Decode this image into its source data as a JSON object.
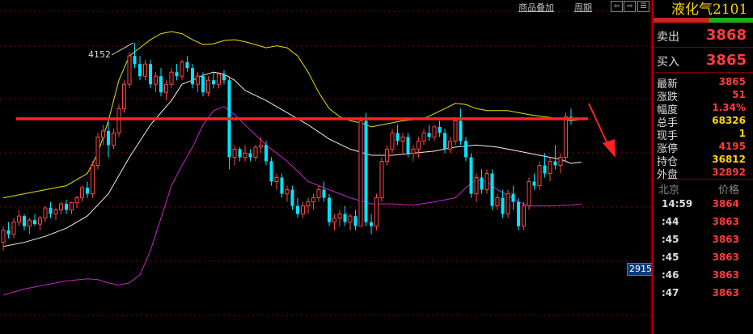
{
  "toolbar": {
    "overlay_label": "商品叠加",
    "period_label": "周期",
    "nav_buttons": [
      "⇦",
      "⇨",
      "☰"
    ]
  },
  "chart": {
    "high_label": "4152",
    "price_tag": "2915",
    "colors": {
      "up": "#ff4444",
      "down": "#00e5ff",
      "upper_band": "#e8e000",
      "mid_band": "#f0f0e0",
      "lower_band": "#cc22cc",
      "resistance_line": "#ff2222",
      "arrow": "#ff2222",
      "grid": "#8b0000"
    }
  },
  "chart_data": {
    "type": "candlestick",
    "ohlc": [
      [
        3660,
        3700,
        3640,
        3690
      ],
      [
        3690,
        3710,
        3670,
        3680
      ],
      [
        3680,
        3720,
        3670,
        3710
      ],
      [
        3710,
        3740,
        3700,
        3725
      ],
      [
        3725,
        3730,
        3690,
        3700
      ],
      [
        3700,
        3720,
        3680,
        3715
      ],
      [
        3715,
        3730,
        3700,
        3705
      ],
      [
        3705,
        3725,
        3690,
        3720
      ],
      [
        3720,
        3750,
        3710,
        3745
      ],
      [
        3745,
        3760,
        3720,
        3730
      ],
      [
        3730,
        3745,
        3715,
        3740
      ],
      [
        3740,
        3760,
        3730,
        3755
      ],
      [
        3755,
        3765,
        3730,
        3740
      ],
      [
        3740,
        3760,
        3730,
        3758
      ],
      [
        3758,
        3775,
        3745,
        3770
      ],
      [
        3770,
        3800,
        3760,
        3795
      ],
      [
        3795,
        3810,
        3770,
        3780
      ],
      [
        3780,
        3860,
        3770,
        3850
      ],
      [
        3850,
        3930,
        3840,
        3920
      ],
      [
        3920,
        3950,
        3900,
        3935
      ],
      [
        3935,
        3960,
        3870,
        3900
      ],
      [
        3900,
        3940,
        3890,
        3930
      ],
      [
        3930,
        4000,
        3920,
        3990
      ],
      [
        3990,
        4060,
        3980,
        4050
      ],
      [
        4050,
        4130,
        4040,
        4120
      ],
      [
        4120,
        4152,
        4090,
        4100
      ],
      [
        4100,
        4120,
        4060,
        4070
      ],
      [
        4070,
        4110,
        4060,
        4100
      ],
      [
        4100,
        4110,
        4040,
        4050
      ],
      [
        4050,
        4080,
        4030,
        4070
      ],
      [
        4070,
        4090,
        4020,
        4030
      ],
      [
        4030,
        4060,
        4010,
        4050
      ],
      [
        4050,
        4090,
        4040,
        4080
      ],
      [
        4080,
        4100,
        4060,
        4070
      ],
      [
        4070,
        4110,
        4060,
        4105
      ],
      [
        4105,
        4120,
        4080,
        4090
      ],
      [
        4090,
        4100,
        4040,
        4050
      ],
      [
        4050,
        4080,
        4030,
        4070
      ],
      [
        4070,
        4080,
        4020,
        4030
      ],
      [
        4030,
        4070,
        4020,
        4060
      ],
      [
        4060,
        4080,
        4040,
        4050
      ],
      [
        4050,
        4080,
        4040,
        4075
      ],
      [
        4075,
        4085,
        4050,
        4060
      ],
      [
        4060,
        4070,
        3840,
        3870
      ],
      [
        3870,
        3900,
        3850,
        3890
      ],
      [
        3890,
        3895,
        3860,
        3870
      ],
      [
        3870,
        3900,
        3860,
        3880
      ],
      [
        3880,
        3890,
        3860,
        3870
      ],
      [
        3870,
        3900,
        3860,
        3895
      ],
      [
        3895,
        3920,
        3880,
        3900
      ],
      [
        3900,
        3910,
        3850,
        3860
      ],
      [
        3860,
        3870,
        3800,
        3810
      ],
      [
        3810,
        3830,
        3790,
        3820
      ],
      [
        3820,
        3830,
        3770,
        3780
      ],
      [
        3780,
        3800,
        3760,
        3790
      ],
      [
        3790,
        3800,
        3740,
        3750
      ],
      [
        3750,
        3770,
        3720,
        3730
      ],
      [
        3730,
        3760,
        3720,
        3750
      ],
      [
        3750,
        3770,
        3730,
        3760
      ],
      [
        3760,
        3780,
        3740,
        3770
      ],
      [
        3770,
        3800,
        3760,
        3790
      ],
      [
        3790,
        3810,
        3760,
        3770
      ],
      [
        3770,
        3780,
        3700,
        3710
      ],
      [
        3710,
        3730,
        3690,
        3720
      ],
      [
        3720,
        3740,
        3700,
        3730
      ],
      [
        3730,
        3750,
        3700,
        3710
      ],
      [
        3710,
        3730,
        3690,
        3725
      ],
      [
        3725,
        3740,
        3690,
        3700
      ],
      [
        3700,
        3970,
        3700,
        3960
      ],
      [
        3960,
        3980,
        3700,
        3710
      ],
      [
        3710,
        3730,
        3680,
        3700
      ],
      [
        3700,
        3780,
        3690,
        3770
      ],
      [
        3770,
        3870,
        3760,
        3860
      ],
      [
        3860,
        3900,
        3850,
        3890
      ],
      [
        3890,
        3940,
        3880,
        3930
      ],
      [
        3930,
        3950,
        3900,
        3910
      ],
      [
        3910,
        3930,
        3880,
        3920
      ],
      [
        3920,
        3930,
        3870,
        3880
      ],
      [
        3880,
        3900,
        3860,
        3890
      ],
      [
        3890,
        3920,
        3870,
        3910
      ],
      [
        3910,
        3940,
        3900,
        3930
      ],
      [
        3930,
        3950,
        3910,
        3920
      ],
      [
        3920,
        3950,
        3910,
        3945
      ],
      [
        3945,
        3960,
        3920,
        3930
      ],
      [
        3930,
        3940,
        3880,
        3890
      ],
      [
        3890,
        3920,
        3880,
        3910
      ],
      [
        3910,
        3970,
        3900,
        3960
      ],
      [
        3960,
        3990,
        3900,
        3910
      ],
      [
        3910,
        3920,
        3860,
        3870
      ],
      [
        3870,
        3880,
        3770,
        3780
      ],
      [
        3780,
        3830,
        3760,
        3820
      ],
      [
        3820,
        3840,
        3780,
        3790
      ],
      [
        3790,
        3840,
        3780,
        3830
      ],
      [
        3830,
        3840,
        3740,
        3750
      ],
      [
        3750,
        3780,
        3740,
        3770
      ],
      [
        3770,
        3790,
        3720,
        3730
      ],
      [
        3730,
        3790,
        3720,
        3780
      ],
      [
        3780,
        3800,
        3740,
        3760
      ],
      [
        3760,
        3770,
        3690,
        3700
      ],
      [
        3700,
        3760,
        3690,
        3750
      ],
      [
        3750,
        3820,
        3740,
        3810
      ],
      [
        3810,
        3830,
        3790,
        3800
      ],
      [
        3800,
        3860,
        3790,
        3850
      ],
      [
        3850,
        3880,
        3820,
        3830
      ],
      [
        3830,
        3870,
        3810,
        3860
      ],
      [
        3860,
        3900,
        3840,
        3850
      ],
      [
        3850,
        3880,
        3830,
        3870
      ],
      [
        3870,
        3980,
        3860,
        3970
      ],
      [
        3970,
        3990,
        3950,
        3965
      ]
    ],
    "bands": {
      "upper": [
        [
          0,
          3770
        ],
        [
          4,
          3780
        ],
        [
          8,
          3790
        ],
        [
          12,
          3800
        ],
        [
          16,
          3830
        ],
        [
          18,
          3880
        ],
        [
          20,
          3960
        ],
        [
          22,
          4060
        ],
        [
          24,
          4120
        ],
        [
          26,
          4140
        ],
        [
          28,
          4160
        ],
        [
          30,
          4175
        ],
        [
          32,
          4180
        ],
        [
          34,
          4175
        ],
        [
          36,
          4160
        ],
        [
          38,
          4148
        ],
        [
          40,
          4150
        ],
        [
          42,
          4158
        ],
        [
          44,
          4160
        ],
        [
          46,
          4155
        ],
        [
          48,
          4148
        ],
        [
          50,
          4140
        ],
        [
          52,
          4145
        ],
        [
          54,
          4140
        ],
        [
          56,
          4120
        ],
        [
          58,
          4080
        ],
        [
          60,
          4030
        ],
        [
          62,
          3990
        ],
        [
          64,
          3970
        ],
        [
          66,
          3960
        ],
        [
          68,
          3955
        ],
        [
          70,
          3945
        ],
        [
          72,
          3950
        ],
        [
          76,
          3960
        ],
        [
          80,
          3965
        ],
        [
          84,
          3990
        ],
        [
          86,
          4003
        ],
        [
          88,
          4000
        ],
        [
          90,
          3990
        ],
        [
          92,
          3985
        ],
        [
          94,
          3985
        ],
        [
          96,
          3985
        ],
        [
          98,
          3980
        ],
        [
          100,
          3975
        ],
        [
          104,
          3968
        ],
        [
          108,
          3960
        ],
        [
          110,
          3963
        ]
      ],
      "middle": [
        [
          0,
          3650
        ],
        [
          4,
          3660
        ],
        [
          8,
          3675
        ],
        [
          12,
          3695
        ],
        [
          16,
          3725
        ],
        [
          20,
          3780
        ],
        [
          24,
          3870
        ],
        [
          28,
          3950
        ],
        [
          32,
          4010
        ],
        [
          34,
          4050
        ],
        [
          36,
          4060
        ],
        [
          38,
          4072
        ],
        [
          40,
          4080
        ],
        [
          42,
          4075
        ],
        [
          44,
          4060
        ],
        [
          46,
          4035
        ],
        [
          50,
          4010
        ],
        [
          54,
          3980
        ],
        [
          58,
          3950
        ],
        [
          62,
          3915
        ],
        [
          66,
          3890
        ],
        [
          70,
          3875
        ],
        [
          74,
          3875
        ],
        [
          78,
          3880
        ],
        [
          82,
          3885
        ],
        [
          86,
          3895
        ],
        [
          90,
          3900
        ],
        [
          94,
          3895
        ],
        [
          98,
          3885
        ],
        [
          102,
          3875
        ],
        [
          106,
          3865
        ],
        [
          108,
          3855
        ],
        [
          110,
          3858
        ]
      ],
      "lower": [
        [
          0,
          3530
        ],
        [
          4,
          3545
        ],
        [
          8,
          3555
        ],
        [
          12,
          3565
        ],
        [
          16,
          3570
        ],
        [
          18,
          3568
        ],
        [
          20,
          3560
        ],
        [
          22,
          3555
        ],
        [
          24,
          3560
        ],
        [
          26,
          3580
        ],
        [
          28,
          3640
        ],
        [
          30,
          3720
        ],
        [
          32,
          3800
        ],
        [
          34,
          3850
        ],
        [
          36,
          3895
        ],
        [
          38,
          3950
        ],
        [
          40,
          3985
        ],
        [
          42,
          3995
        ],
        [
          44,
          3975
        ],
        [
          46,
          3950
        ],
        [
          50,
          3900
        ],
        [
          54,
          3860
        ],
        [
          58,
          3810
        ],
        [
          62,
          3790
        ],
        [
          66,
          3770
        ],
        [
          70,
          3755
        ],
        [
          74,
          3755
        ],
        [
          78,
          3752
        ],
        [
          82,
          3760
        ],
        [
          86,
          3770
        ],
        [
          88,
          3795
        ],
        [
          90,
          3815
        ],
        [
          92,
          3810
        ],
        [
          94,
          3790
        ],
        [
          96,
          3775
        ],
        [
          98,
          3760
        ],
        [
          100,
          3750
        ],
        [
          104,
          3750
        ],
        [
          108,
          3752
        ],
        [
          110,
          3755
        ]
      ]
    },
    "resistance": 3965,
    "ylim": [
      3450,
      4230
    ],
    "annotation_high": 4152
  },
  "panel": {
    "title": "液化气2101",
    "sell": {
      "label": "卖出",
      "value": "3868"
    },
    "buy": {
      "label": "买入",
      "value": "3865"
    },
    "stats": [
      {
        "label": "最新",
        "value": "3865",
        "color": "red"
      },
      {
        "label": "涨跌",
        "value": "51",
        "color": "red"
      },
      {
        "label": "幅度",
        "value": "1.34%",
        "color": "red"
      },
      {
        "label": "总手",
        "value": "68326",
        "color": "yellow"
      },
      {
        "label": "现手",
        "value": "1",
        "color": "yellow"
      },
      {
        "label": "涨停",
        "value": "4195",
        "color": "red"
      },
      {
        "label": "持仓",
        "value": "36812",
        "color": "yellow"
      },
      {
        "label": "外盘",
        "value": "32892",
        "color": "red"
      }
    ],
    "ticks_header": {
      "left": "北京",
      "right": "价格"
    },
    "ticks": [
      {
        "time": "14:59",
        "price": "3864"
      },
      {
        "time": ":44",
        "price": "3863"
      },
      {
        "time": ":45",
        "price": "3863"
      },
      {
        "time": ":45",
        "price": "3863"
      },
      {
        "time": ":46",
        "price": "3863"
      },
      {
        "time": ":47",
        "price": "3863"
      }
    ]
  }
}
